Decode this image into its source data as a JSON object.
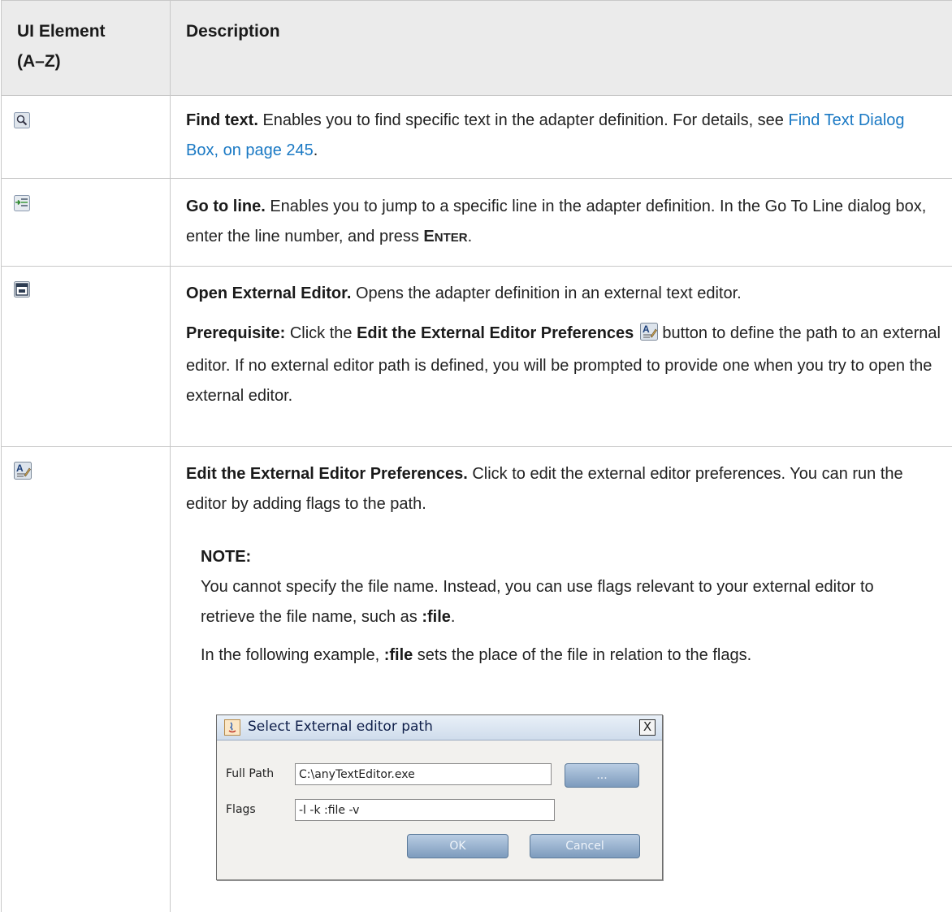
{
  "table": {
    "header": {
      "col1": "UI Element",
      "col1_sub": "(A–Z)",
      "col2": "Description"
    },
    "rows": [
      {
        "icon": "find-text-icon",
        "title": "Find text.",
        "text_a": " Enables you to find specific text in the adapter definition. For details, see ",
        "link": "Find Text Dialog Box, on page 245",
        "text_b": "."
      },
      {
        "icon": "go-to-line-icon",
        "title": "Go to line.",
        "text_a": " Enables you to jump to a specific line in the adapter definition. In the Go To Line dialog box, enter the line number, and press ",
        "key_first": "E",
        "key_rest": "NTER",
        "text_b": "."
      },
      {
        "icon": "open-external-editor-icon",
        "title": "Open External Editor.",
        "text_a": " Opens the adapter definition in an external text editor.",
        "prereq_label": "Prerequisite:",
        "prereq_a": " Click the ",
        "prereq_bold": "Edit the External Editor Preferences",
        "prereq_b": " button to define the path to an external editor. If no external editor path is defined, you will be prompted to provide one when you try to open the external editor."
      },
      {
        "icon": "edit-external-editor-preferences-icon",
        "title": "Edit the External Editor Preferences.",
        "text_a": " Click to edit the external editor preferences. You can run the editor by adding flags to the path.",
        "note_label": "NOTE:",
        "note_text_a": "You cannot specify the file name. Instead, you can use flags relevant to your external editor to retrieve the file name, such as ",
        "note_bold": ":file",
        "note_text_b": ".",
        "example_a": "In the following example, ",
        "example_bold": ":file",
        "example_b": " sets the place of the file in relation to the flags."
      }
    ]
  },
  "dialog": {
    "title": "Select External editor path",
    "close_label": "X",
    "full_path_label": "Full Path",
    "full_path_value": "C:\\anyTextEditor.exe",
    "browse_label": "...",
    "flags_label": "Flags",
    "flags_value": "-l -k :file -v",
    "ok_label": "OK",
    "cancel_label": "Cancel"
  }
}
